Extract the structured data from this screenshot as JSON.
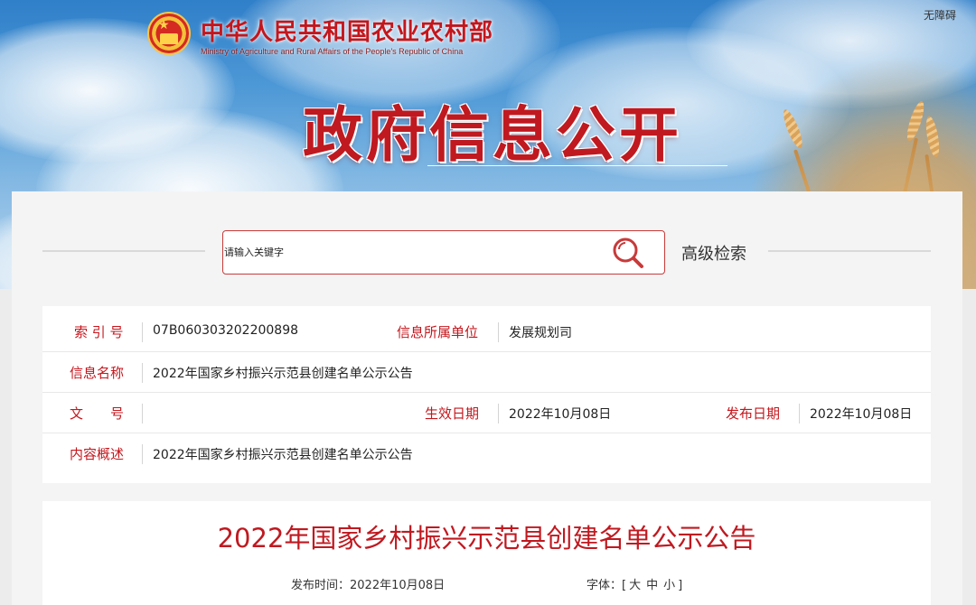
{
  "header": {
    "ministry_name": "中华人民共和国农业农村部",
    "ministry_en": "Ministry of Agriculture and Rural Affairs of the People's Republic of China",
    "accessibility": "无障碍",
    "banner_title": "政府信息公开",
    "emblem_icon": "national-emblem-icon"
  },
  "search": {
    "placeholder": "请输入关键字",
    "value": "",
    "icon": "search-icon",
    "advanced_label": "高级检索"
  },
  "info": {
    "index_label": "索 引 号",
    "index_value": "07B060303202200898",
    "unit_label": "信息所属单位",
    "unit_value": "发展规划司",
    "name_label": "信息名称",
    "name_value": "2022年国家乡村振兴示范县创建名单公示公告",
    "doc_label": "文　　号",
    "doc_value": "",
    "effective_label": "生效日期",
    "effective_value": "2022年10月08日",
    "publish_label": "发布日期",
    "publish_value": "2022年10月08日",
    "summary_label": "内容概述",
    "summary_value": "2022年国家乡村振兴示范县创建名单公示公告"
  },
  "article": {
    "title": "2022年国家乡村振兴示范县创建名单公示公告",
    "publish_time_label": "发布时间：",
    "publish_time_value": "2022年10月08日",
    "font_label": "字体：",
    "font_open": "[",
    "font_large": "大",
    "font_medium": "中",
    "font_small": "小",
    "font_close": "]"
  },
  "colors": {
    "brand_red": "#c4161c",
    "sky_blue": "#4d98d6",
    "panel_bg": "#f4f4f4"
  }
}
